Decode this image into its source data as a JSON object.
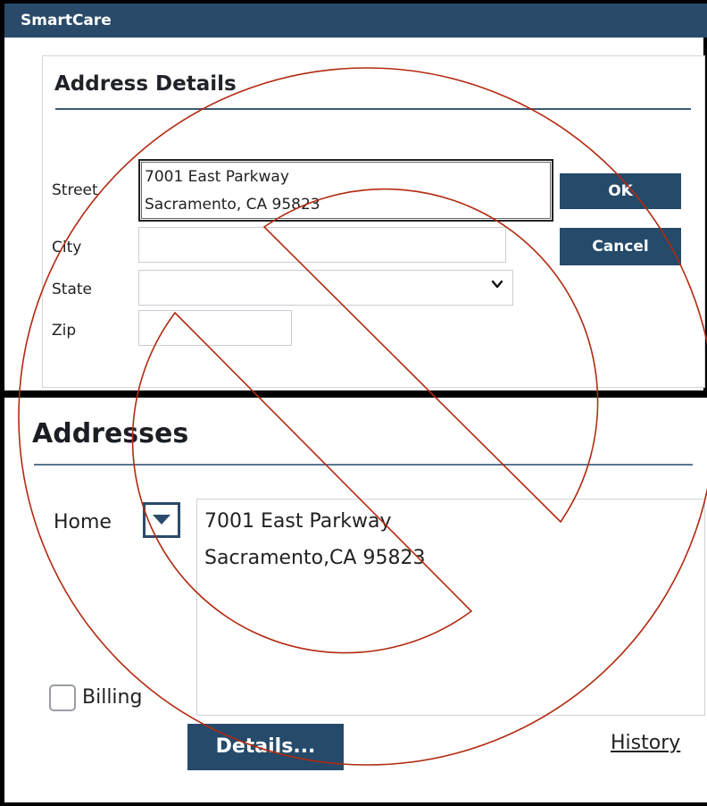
{
  "app": {
    "title": "SmartCare"
  },
  "dialog": {
    "title": "Address Details",
    "street_label": "Street",
    "street_lines": [
      "7001 East Parkway",
      "Sacramento, CA 95823"
    ],
    "city_label": "City",
    "city_value": "",
    "state_label": "State",
    "state_value": "",
    "zip_label": "Zip",
    "zip_value": "",
    "ok_label": "OK",
    "cancel_label": "Cancel"
  },
  "addresses": {
    "title": "Addresses",
    "type_label": "Home",
    "address_lines": [
      "7001 East Parkway",
      "Sacramento,CA 95823"
    ],
    "billing_label": "Billing",
    "billing_checked": false,
    "details_label": "Details...",
    "history_label": "History"
  },
  "colors": {
    "title_bar": "#2a4a6a",
    "button": "#254a6a",
    "prohibition_overlay": "#b22a10"
  },
  "icons": {
    "state_dropdown": "chevron-down-icon",
    "type_dropdown": "caret-down-icon",
    "overlay": "prohibition-sign-icon"
  }
}
